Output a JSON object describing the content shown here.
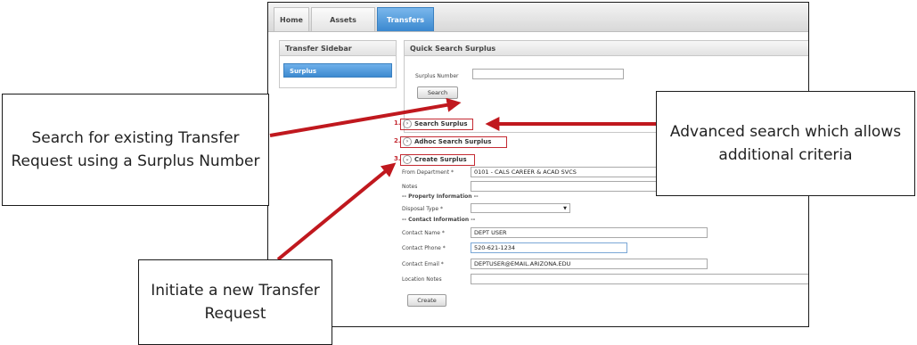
{
  "nav": {
    "tabs": [
      {
        "label": "Home"
      },
      {
        "label": "Assets"
      },
      {
        "label": "Transfers"
      }
    ]
  },
  "sidebar": {
    "title": "Transfer Sidebar",
    "items": [
      {
        "label": "Surplus"
      }
    ]
  },
  "quick_search": {
    "title": "Quick Search Surplus",
    "field_label": "Surplus Number",
    "field_value": "",
    "button_label": "Search"
  },
  "sections": [
    {
      "number": "1.",
      "label": "Search Surplus"
    },
    {
      "number": "2.",
      "label": "Adhoc Search Surplus"
    },
    {
      "number": "3.",
      "label": "Create Surplus"
    }
  ],
  "create_form": {
    "from_department_label": "From Department *",
    "from_department_value": "0101 - CALS CAREER & ACAD SVCS",
    "notes_label": "Notes",
    "notes_value": "",
    "property_heading": "-- Property Information --",
    "disposal_type_label": "Disposal Type *",
    "disposal_type_value": "",
    "contact_heading": "-- Contact Information --",
    "contact_name_label": "Contact Name *",
    "contact_name_value": "DEPT USER",
    "contact_phone_label": "Contact Phone *",
    "contact_phone_value": "520-621-1234",
    "contact_email_label": "Contact Email *",
    "contact_email_value": "DEPTUSER@EMAIL.ARIZONA.EDU",
    "location_notes_label": "Location Notes",
    "location_notes_value": "",
    "create_button_label": "Create"
  },
  "callouts": {
    "search_existing": "Search for existing Transfer Request using a Surplus Number",
    "advanced_search": "Advanced search which allows additional criteria",
    "initiate_new": "Initiate a new Transfer Request"
  },
  "colors": {
    "arrow": "#c0181e",
    "tab_active": "#4a95d8",
    "section_border": "#c42a32"
  }
}
